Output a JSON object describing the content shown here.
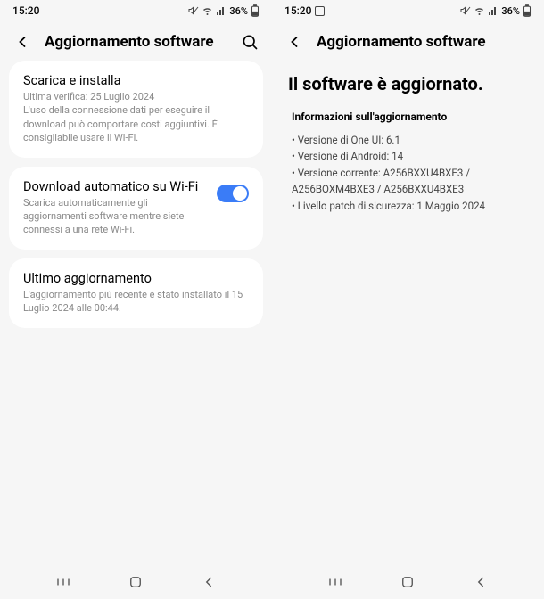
{
  "left": {
    "status": {
      "time": "15:20",
      "battery": "36%"
    },
    "header": {
      "title": "Aggiornamento software"
    },
    "card1": {
      "title": "Scarica e installa",
      "line1": "Ultima verifica: 25 Luglio 2024",
      "line2": "L'uso della connessione dati per eseguire il download può comportare costi aggiuntivi. È consigliabile usare il Wi-Fi."
    },
    "card2": {
      "title": "Download automatico su Wi-Fi",
      "desc": "Scarica automaticamente gli aggiornamenti software mentre siete connessi a una rete Wi-Fi."
    },
    "card3": {
      "title": "Ultimo aggiornamento",
      "desc": "L'aggiornamento più recente è stato installato il 15 Luglio 2024 alle 00:44."
    }
  },
  "right": {
    "status": {
      "time": "15:20",
      "battery": "36%"
    },
    "header": {
      "title": "Aggiornamento software"
    },
    "headline": "Il software è aggiornato.",
    "info_heading": "Informazioni sull'aggiornamento",
    "items": {
      "i1": "Versione di One UI: 6.1",
      "i2": "Versione di Android: 14",
      "i3": "Versione corrente: A256BXXU4BXE3 / A256BOXM4BXE3 / A256BXXU4BXE3",
      "i4": "Livello patch di sicurezza: 1 Maggio 2024"
    }
  }
}
